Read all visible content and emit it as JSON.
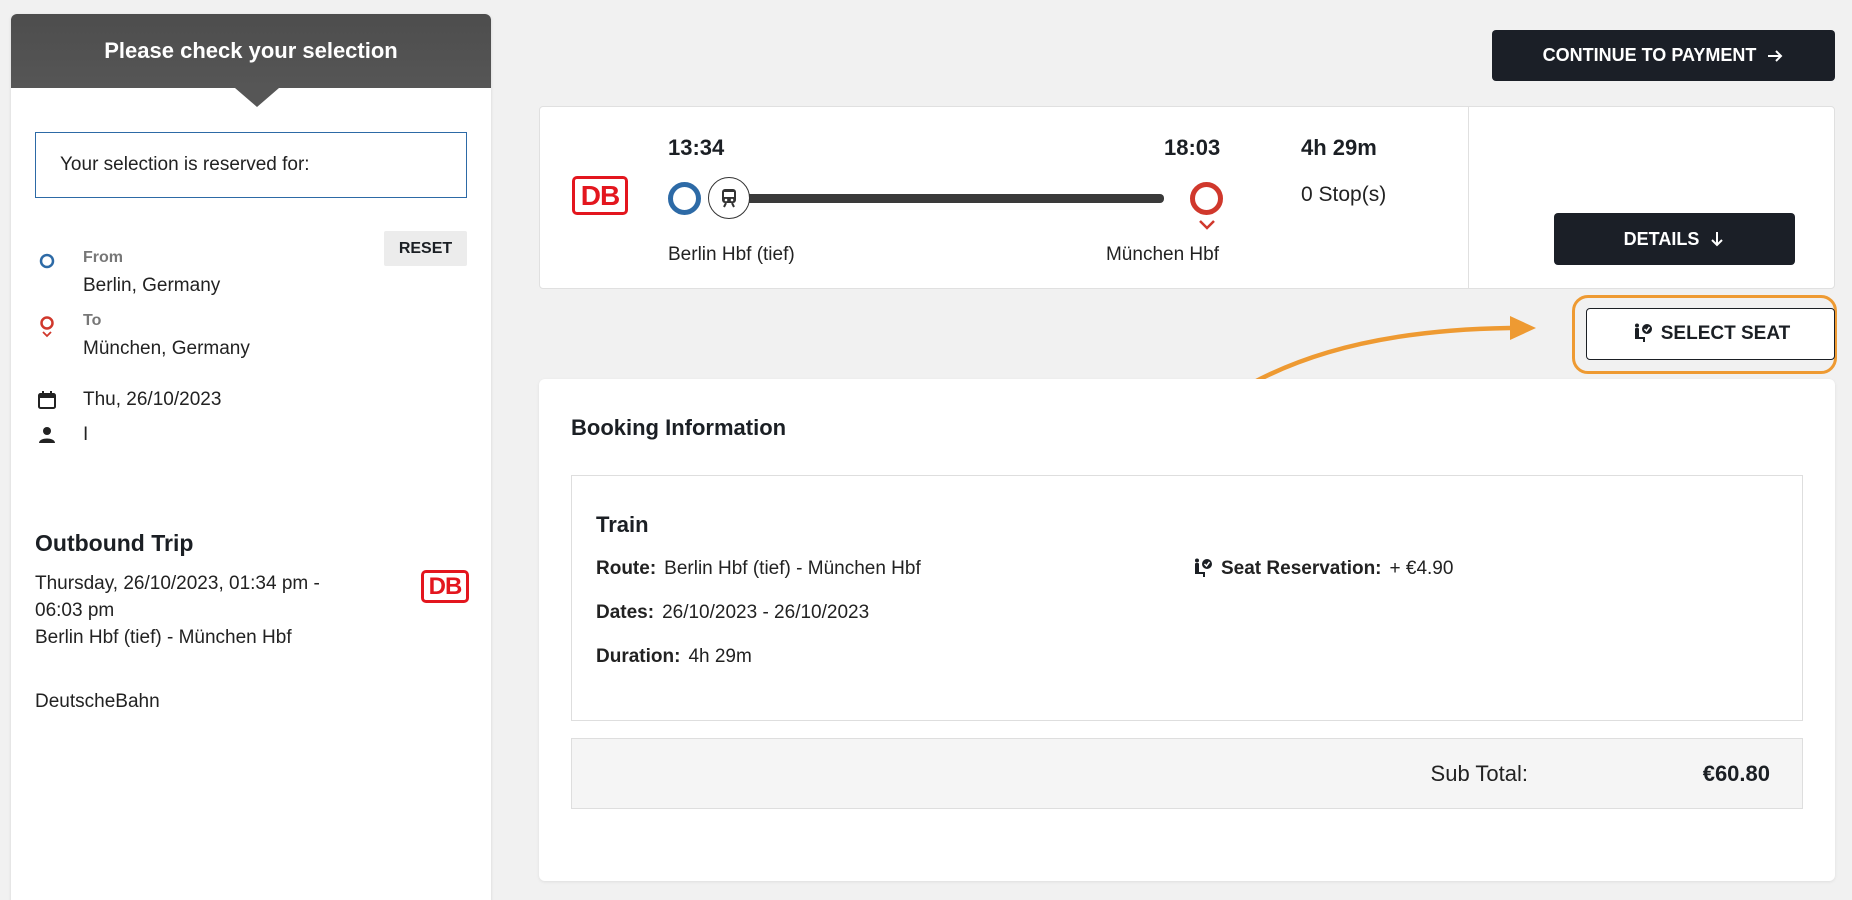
{
  "sidebar": {
    "header_title": "Please check your selection",
    "reserved_text": "Your selection is reserved for:",
    "reset_label": "RESET",
    "from_label": "From",
    "from_value": "Berlin, Germany",
    "to_label": "To",
    "to_value": "München, Germany",
    "date": "Thu, 26/10/2023",
    "passengers": "I",
    "outbound_title": "Outbound Trip",
    "outbound_datetime": "Thursday, 26/10/2023, 01:34 pm - 06:03 pm",
    "outbound_route": "Berlin Hbf (tief) - München Hbf",
    "operator": "DeutscheBahn",
    "logo_text": "DB"
  },
  "actions": {
    "continue_label": "CONTINUE TO PAYMENT",
    "details_label": "DETAILS",
    "select_seat_label": "SELECT SEAT"
  },
  "trip": {
    "logo_text": "DB",
    "departure_time": "13:34",
    "arrival_time": "18:03",
    "departure_station": "Berlin Hbf (tief)",
    "arrival_station": "München Hbf",
    "duration": "4h 29m",
    "stops": "0 Stop(s)"
  },
  "booking": {
    "title": "Booking Information",
    "mode": "Train",
    "route_label": "Route:",
    "route_value": "Berlin Hbf (tief) - München Hbf",
    "dates_label": "Dates:",
    "dates_value": "26/10/2023 - 26/10/2023",
    "duration_label": "Duration:",
    "duration_value": "4h 29m",
    "seat_res_label": "Seat Reservation:",
    "seat_res_value": "+ €4.90",
    "subtotal_label": "Sub Total:",
    "subtotal_value": "€60.80"
  },
  "colors": {
    "accent_blue": "#2d6aa6",
    "accent_red": "#d0382c",
    "db_red": "#e3161e",
    "dark_button": "#1b1f27",
    "highlight_orange": "#ee9a32"
  }
}
